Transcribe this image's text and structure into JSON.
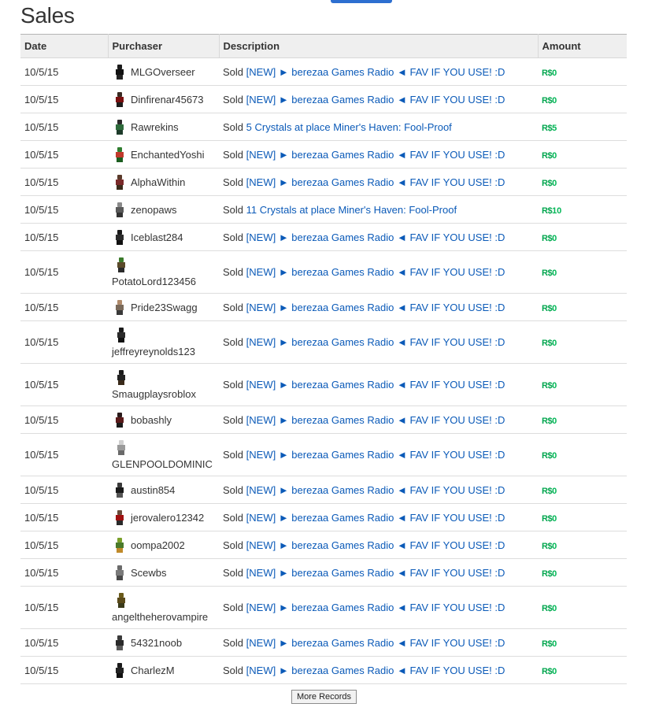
{
  "page": {
    "title": "Sales"
  },
  "table": {
    "headers": {
      "date": "Date",
      "purchaser": "Purchaser",
      "description": "Description",
      "amount": "Amount"
    },
    "currency": "R$",
    "rows": [
      {
        "date": "10/5/15",
        "purchaser": "MLGOverseer",
        "sold": "Sold",
        "item": "[NEW] ► berezaa Games Radio ◄ FAV IF YOU USE! :D",
        "amount": "0",
        "tall": false,
        "avatar": [
          "#1b1b1b",
          "#111111",
          "#222222"
        ]
      },
      {
        "date": "10/5/15",
        "purchaser": "Dinfirenar45673",
        "sold": "Sold",
        "item": "[NEW] ► berezaa Games Radio ◄ FAV IF YOU USE! :D",
        "amount": "0",
        "tall": false,
        "avatar": [
          "#3a2a22",
          "#7a1010",
          "#1c1c1c"
        ]
      },
      {
        "date": "10/5/15",
        "purchaser": "Rawrekins",
        "sold": "Sold",
        "item": "5 Crystals at place Miner's Haven: Fool-Proof",
        "amount": "5",
        "tall": false,
        "avatar": [
          "#2a2a2a",
          "#2e6b3c",
          "#1d3b2a"
        ]
      },
      {
        "date": "10/5/15",
        "purchaser": "EnchantedYoshi",
        "sold": "Sold",
        "item": "[NEW] ► berezaa Games Radio ◄ FAV IF YOU USE! :D",
        "amount": "0",
        "tall": false,
        "avatar": [
          "#2f7d2f",
          "#c0392b",
          "#1b5e20"
        ]
      },
      {
        "date": "10/5/15",
        "purchaser": "AlphaWithin",
        "sold": "Sold",
        "item": "[NEW] ► berezaa Games Radio ◄ FAV IF YOU USE! :D",
        "amount": "0",
        "tall": false,
        "avatar": [
          "#5a3a2a",
          "#7a2a2a",
          "#3b2b1b"
        ]
      },
      {
        "date": "10/5/15",
        "purchaser": "zenopaws",
        "sold": "Sold",
        "item": "11 Crystals at place Miner's Haven: Fool-Proof",
        "amount": "10",
        "tall": false,
        "avatar": [
          "#8a8a8a",
          "#5a5a5a",
          "#333333"
        ]
      },
      {
        "date": "10/5/15",
        "purchaser": "Iceblast284",
        "sold": "Sold",
        "item": "[NEW] ► berezaa Games Radio ◄ FAV IF YOU USE! :D",
        "amount": "0",
        "tall": false,
        "avatar": [
          "#1a1a1a",
          "#2b2b2b",
          "#111111"
        ]
      },
      {
        "date": "10/5/15",
        "purchaser": "PotatoLord123456",
        "sold": "Sold",
        "item": "[NEW] ► berezaa Games Radio ◄ FAV IF YOU USE! :D",
        "amount": "0",
        "tall": true,
        "avatar": [
          "#3a7a2a",
          "#5a4a2a",
          "#2a2a2a"
        ]
      },
      {
        "date": "10/5/15",
        "purchaser": "Pride23Swagg",
        "sold": "Sold",
        "item": "[NEW] ► berezaa Games Radio ◄ FAV IF YOU USE! :D",
        "amount": "0",
        "tall": false,
        "avatar": [
          "#b08a6a",
          "#7a6a5a",
          "#3a3a3a"
        ]
      },
      {
        "date": "10/5/15",
        "purchaser": "jeffreyreynolds123",
        "sold": "Sold",
        "item": "[NEW] ► berezaa Games Radio ◄ FAV IF YOU USE! :D",
        "amount": "0",
        "tall": true,
        "avatar": [
          "#1a1a1a",
          "#2a2a2a",
          "#111111"
        ]
      },
      {
        "date": "10/5/15",
        "purchaser": "Smaugplaysroblox",
        "sold": "Sold",
        "item": "[NEW] ► berezaa Games Radio ◄ FAV IF YOU USE! :D",
        "amount": "0",
        "tall": true,
        "avatar": [
          "#1a1a1a",
          "#222222",
          "#3a2a1a"
        ]
      },
      {
        "date": "10/5/15",
        "purchaser": "bobashly",
        "sold": "Sold",
        "item": "[NEW] ► berezaa Games Radio ◄ FAV IF YOU USE! :D",
        "amount": "0",
        "tall": false,
        "avatar": [
          "#2a1a1a",
          "#5a1a1a",
          "#1a1a1a"
        ]
      },
      {
        "date": "10/5/15",
        "purchaser": "GLENPOOLDOMINIC",
        "sold": "Sold",
        "item": "[NEW] ► berezaa Games Radio ◄ FAV IF YOU USE! :D",
        "amount": "0",
        "tall": true,
        "avatar": [
          "#cfcfcf",
          "#9a9a9a",
          "#6a6a6a"
        ]
      },
      {
        "date": "10/5/15",
        "purchaser": "austin854",
        "sold": "Sold",
        "item": "[NEW] ► berezaa Games Radio ◄ FAV IF YOU USE! :D",
        "amount": "0",
        "tall": false,
        "avatar": [
          "#3a3a3a",
          "#1a1a1a",
          "#555555"
        ]
      },
      {
        "date": "10/5/15",
        "purchaser": "jerovalero12342",
        "sold": "Sold",
        "item": "[NEW] ► berezaa Games Radio ◄ FAV IF YOU USE! :D",
        "amount": "0",
        "tall": false,
        "avatar": [
          "#6a4a3a",
          "#a01010",
          "#2a2a2a"
        ]
      },
      {
        "date": "10/5/15",
        "purchaser": "oompa2002",
        "sold": "Sold",
        "item": "[NEW] ► berezaa Games Radio ◄ FAV IF YOU USE! :D",
        "amount": "0",
        "tall": false,
        "avatar": [
          "#7aa02a",
          "#4a7a2a",
          "#c08a2a"
        ]
      },
      {
        "date": "10/5/15",
        "purchaser": "Scewbs",
        "sold": "Sold",
        "item": "[NEW] ► berezaa Games Radio ◄ FAV IF YOU USE! :D",
        "amount": "0",
        "tall": false,
        "avatar": [
          "#6a6a6a",
          "#7a7a7a",
          "#4a4a4a"
        ]
      },
      {
        "date": "10/5/15",
        "purchaser": "angeltheherovampire",
        "sold": "Sold",
        "item": "[NEW] ► berezaa Games Radio ◄ FAV IF YOU USE! :D",
        "amount": "0",
        "tall": true,
        "avatar": [
          "#6a5a1a",
          "#5a4a1a",
          "#3a3a1a"
        ]
      },
      {
        "date": "10/5/15",
        "purchaser": "54321noob",
        "sold": "Sold",
        "item": "[NEW] ► berezaa Games Radio ◄ FAV IF YOU USE! :D",
        "amount": "0",
        "tall": false,
        "avatar": [
          "#3a3a3a",
          "#2a2a2a",
          "#5a5a5a"
        ]
      },
      {
        "date": "10/5/15",
        "purchaser": "CharlezM",
        "sold": "Sold",
        "item": "[NEW] ► berezaa Games Radio ◄ FAV IF YOU USE! :D",
        "amount": "0",
        "tall": false,
        "avatar": [
          "#1a1a1a",
          "#222222",
          "#111111"
        ]
      }
    ]
  },
  "more_button": {
    "label": "More Records"
  }
}
